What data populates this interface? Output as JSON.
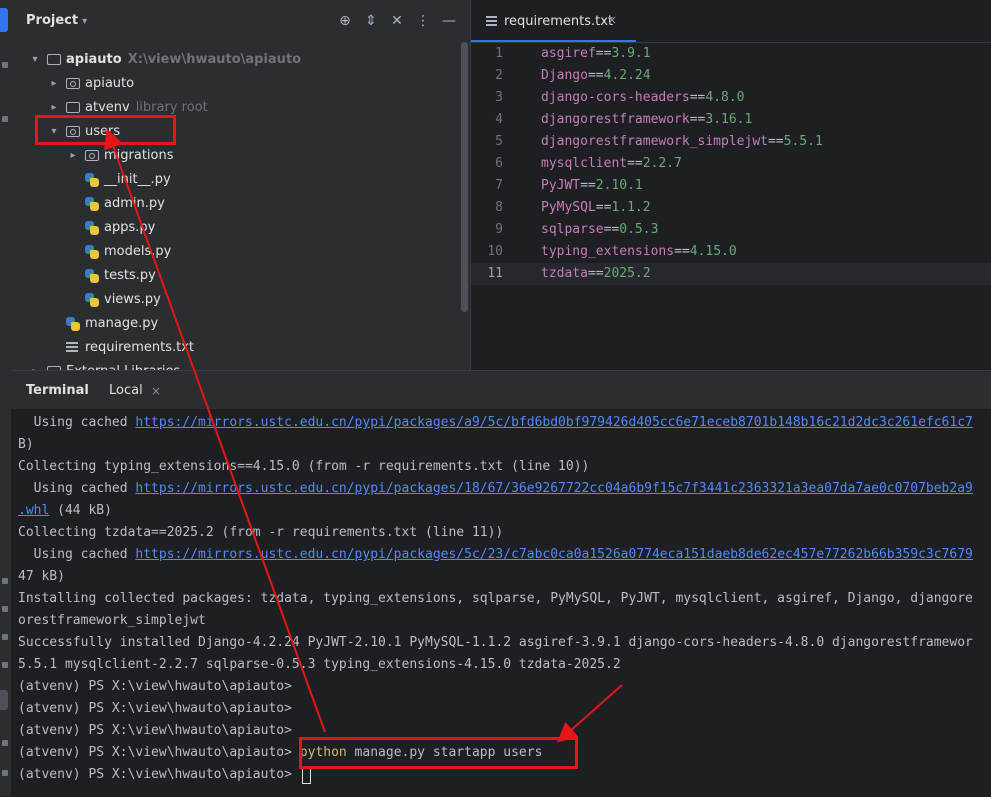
{
  "project": {
    "title": "Project",
    "tree": [
      {
        "label": "apiauto",
        "hint": "X:\\view\\hwauto\\apiauto",
        "kind": "folder",
        "bold": true
      },
      {
        "label": "apiauto",
        "hint": "",
        "kind": "pkg"
      },
      {
        "label": "atvenv",
        "hint": "library root",
        "kind": "folder"
      },
      {
        "label": "users",
        "hint": "",
        "kind": "pkg"
      },
      {
        "label": "migrations",
        "hint": "",
        "kind": "pkg"
      },
      {
        "label": "__init__.py",
        "hint": "",
        "kind": "py"
      },
      {
        "label": "admin.py",
        "hint": "",
        "kind": "py"
      },
      {
        "label": "apps.py",
        "hint": "",
        "kind": "py"
      },
      {
        "label": "models.py",
        "hint": "",
        "kind": "py"
      },
      {
        "label": "tests.py",
        "hint": "",
        "kind": "py"
      },
      {
        "label": "views.py",
        "hint": "",
        "kind": "py"
      },
      {
        "label": "manage.py",
        "hint": "",
        "kind": "py"
      },
      {
        "label": "requirements.txt",
        "hint": "",
        "kind": "txt"
      },
      {
        "label": "External Libraries",
        "hint": "",
        "kind": "folder"
      }
    ]
  },
  "editor": {
    "tab_label": "requirements.txt",
    "tab_close": "×",
    "lines": [
      {
        "num": "1",
        "pkg": "asgiref",
        "op": "==",
        "ver": "3.9.1"
      },
      {
        "num": "2",
        "pkg": "Django",
        "op": "==",
        "ver": "4.2.24"
      },
      {
        "num": "3",
        "pkg": "django-cors-headers",
        "op": "==",
        "ver": "4.8.0"
      },
      {
        "num": "4",
        "pkg": "djangorestframework",
        "op": "==",
        "ver": "3.16.1"
      },
      {
        "num": "5",
        "pkg": "djangorestframework_simplejwt",
        "op": "==",
        "ver": "5.5.1"
      },
      {
        "num": "6",
        "pkg": "mysqlclient",
        "op": "==",
        "ver": "2.2.7"
      },
      {
        "num": "7",
        "pkg": "PyJWT",
        "op": "==",
        "ver": "2.10.1"
      },
      {
        "num": "8",
        "pkg": "PyMySQL",
        "op": "==",
        "ver": "1.1.2"
      },
      {
        "num": "9",
        "pkg": "sqlparse",
        "op": "==",
        "ver": "0.5.3"
      },
      {
        "num": "10",
        "pkg": "typing_extensions",
        "op": "==",
        "ver": "4.15.0"
      },
      {
        "num": "11",
        "pkg": "tzdata",
        "op": "==",
        "ver": "2025.2"
      }
    ]
  },
  "terminal": {
    "title": "Terminal",
    "tab": "Local",
    "tab_close": "×",
    "lines": [
      {
        "pre": "  Using cached ",
        "url": "https://mirrors.ustc.edu.cn/pypi/packages/a9/5c/bfd6bd0bf979426d405cc6e71eceb8701b148b16c21d2dc3c261efc61c7",
        "post": ""
      },
      {
        "pre": "B)",
        "url": "",
        "post": ""
      },
      {
        "pre": "Collecting typing_extensions==4.15.0 (from -r requirements.txt (line 10))",
        "url": "",
        "post": ""
      },
      {
        "pre": "  Using cached ",
        "url": "https://mirrors.ustc.edu.cn/pypi/packages/18/67/36e9267722cc04a6b9f15c7f3441c2363321a3ea07da7ae0c0707beb2a9",
        "post": ""
      },
      {
        "pre": "",
        "url": ".whl",
        "post": " (44 kB)"
      },
      {
        "pre": "Collecting tzdata==2025.2 (from -r requirements.txt (line 11))",
        "url": "",
        "post": ""
      },
      {
        "pre": "  Using cached ",
        "url": "https://mirrors.ustc.edu.cn/pypi/packages/5c/23/c7abc0ca0a1526a0774eca151daeb8de62ec457e77262b66b359c3c7679",
        "post": ""
      },
      {
        "pre": "47 kB)",
        "url": "",
        "post": ""
      },
      {
        "pre": "Installing collected packages: tzdata, typing_extensions, sqlparse, PyMySQL, PyJWT, mysqlclient, asgiref, Django, djangore",
        "url": "",
        "post": ""
      },
      {
        "pre": "orestframework_simplejwt",
        "url": "",
        "post": ""
      },
      {
        "pre": "Successfully installed Django-4.2.24 PyJWT-2.10.1 PyMySQL-1.1.2 asgiref-3.9.1 django-cors-headers-4.8.0 djangorestframewor",
        "url": "",
        "post": ""
      },
      {
        "pre": "5.5.1 mysqlclient-2.2.7 sqlparse-0.5.3 typing_extensions-4.15.0 tzdata-2025.2",
        "url": "",
        "post": ""
      },
      {
        "pre": "(atvenv) PS X:\\view\\hwauto\\apiauto>",
        "url": "",
        "post": ""
      },
      {
        "pre": "(atvenv) PS X:\\view\\hwauto\\apiauto>",
        "url": "",
        "post": ""
      },
      {
        "pre": "(atvenv) PS X:\\view\\hwauto\\apiauto>",
        "url": "",
        "post": ""
      },
      {
        "pre": "(atvenv) PS X:\\view\\hwauto\\apiauto> ",
        "url": "",
        "post": "",
        "cmd": "python",
        "args": " manage.py startapp users"
      },
      {
        "pre": "(atvenv) PS X:\\view\\hwauto\\apiauto> ",
        "url": "",
        "post": "",
        "cursor": true
      }
    ]
  },
  "colors": {
    "annotation": "#e51616",
    "accent": "#3574f0"
  },
  "icons": {
    "header": [
      "crosshair-icon",
      "expand-icon",
      "collapse-icon",
      "more-icon",
      "minimize-icon"
    ]
  }
}
